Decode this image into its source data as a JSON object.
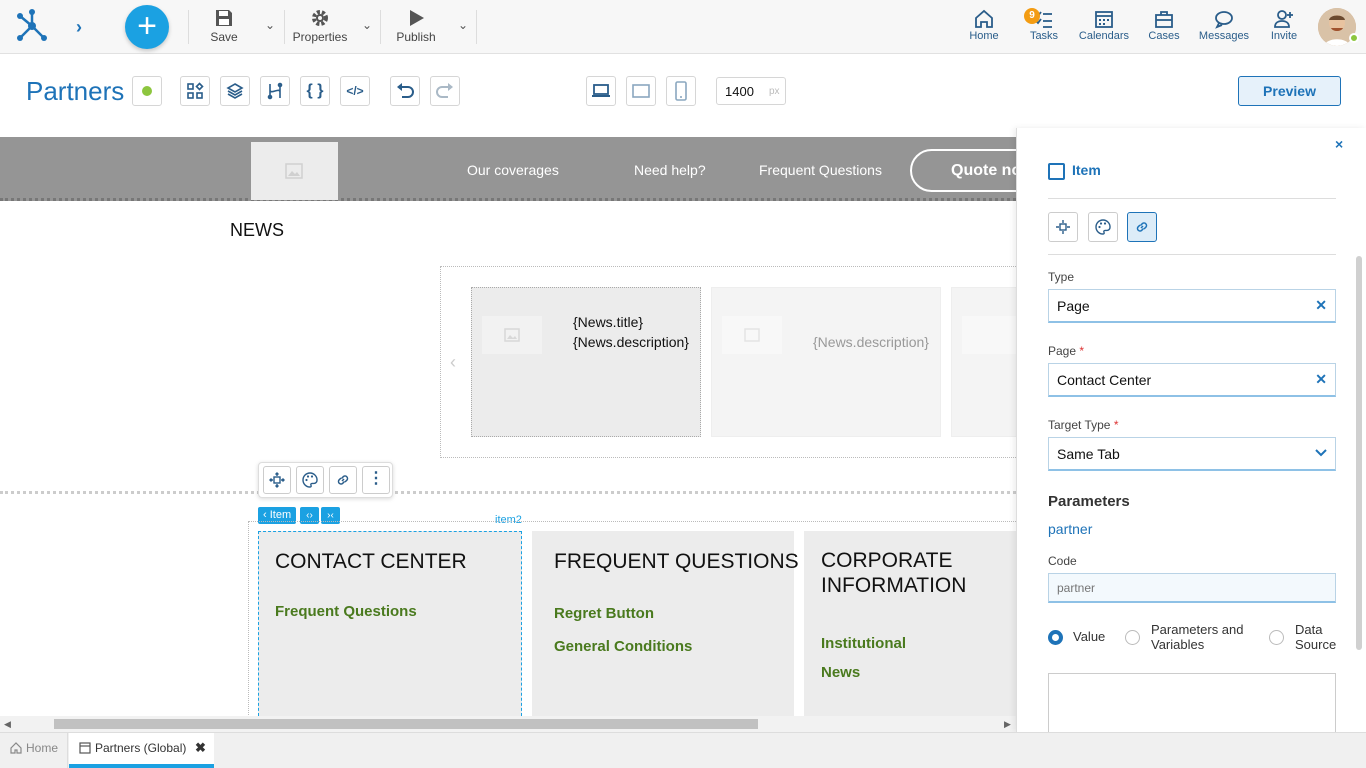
{
  "topbar": {
    "save_label": "Save",
    "properties_label": "Properties",
    "publish_label": "Publish",
    "nav": [
      {
        "label": "Home",
        "icon": "home-icon"
      },
      {
        "label": "Tasks",
        "icon": "tasks-icon",
        "badge": "9"
      },
      {
        "label": "Calendars",
        "icon": "calendar-icon"
      },
      {
        "label": "Cases",
        "icon": "briefcase-icon"
      },
      {
        "label": "Messages",
        "icon": "chat-icon"
      },
      {
        "label": "Invite",
        "icon": "add-user-icon"
      }
    ]
  },
  "toolbar": {
    "page_title": "Partners",
    "width_value": "1400",
    "width_unit": "px",
    "preview_label": "Preview"
  },
  "site": {
    "menu": [
      "Our coverages",
      "Need help?",
      "Frequent Questions"
    ],
    "quote_label": "Quote no",
    "news_heading": "NEWS",
    "news_title": "{News.title}",
    "news_description": "{News.description}",
    "news_description2": "{News.description}",
    "item_label": "Item",
    "item2_label": "item2",
    "columns": [
      {
        "title": "CONTACT CENTER",
        "links": [
          "Frequent Questions"
        ]
      },
      {
        "title": "FREQUENT QUESTIONS",
        "links": [
          "Regret Button",
          "General Conditions"
        ]
      },
      {
        "title": "CORPORATE INFORMATION",
        "links": [
          "Institutional",
          "News"
        ]
      }
    ]
  },
  "panel": {
    "item_title": "Item",
    "type_label": "Type",
    "type_value": "Page",
    "page_label": "Page",
    "page_value": "Contact Center",
    "target_label": "Target Type",
    "target_value": "Same Tab",
    "params_heading": "Parameters",
    "param_name": "partner",
    "code_label": "Code",
    "code_placeholder": "partner",
    "radio_value": "Value",
    "radio_params": "Parameters and Variables",
    "radio_source": "Data Source"
  },
  "tabs": [
    {
      "label": "Home"
    },
    {
      "label": "Partners (Global)"
    }
  ],
  "colors": {
    "accent": "#1ba1e2",
    "brand_blue": "#1e73b8",
    "link_green": "#4a7a1e",
    "status_green": "#8dc63f"
  }
}
